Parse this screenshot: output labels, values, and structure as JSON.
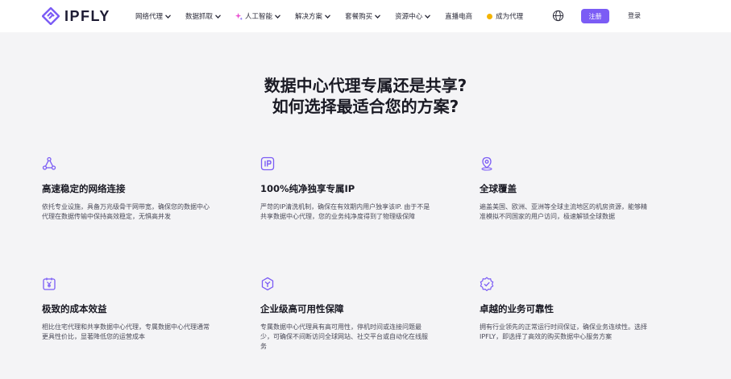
{
  "header": {
    "logo_text": "IPFLY",
    "nav": [
      {
        "label": "网络代理"
      },
      {
        "label": "数据抓取"
      },
      {
        "label": "人工智能"
      },
      {
        "label": "解决方案"
      },
      {
        "label": "套餐购买"
      },
      {
        "label": "资源中心"
      },
      {
        "label": "直播电商"
      },
      {
        "label": "成为代理"
      }
    ],
    "register_label": "注册",
    "login_label": "登录"
  },
  "main": {
    "heading_line1": "数据中心代理专属还是共享?",
    "heading_line2": "如何选择最适合您的方案?",
    "features": [
      {
        "icon": "network-icon",
        "title": "高速稳定的网络连接",
        "desc": "依托专业设施，具备万兆级骨干网带宽，确保您的数据中心代理在数据传输中保持高效稳定，无惧高并发"
      },
      {
        "icon": "ip-icon",
        "title": "100%纯净独享专属IP",
        "desc": "严苛的IP清洗机制，确保在有效期内用户独享该IP. 由于不是共享数据中心代理，您的业务纯净度得到了物理级保障"
      },
      {
        "icon": "location-pin-icon",
        "title": "全球覆盖",
        "desc": "遍盖美国、欧洲、亚洲等全球主流地区的机房资源，能够精准模拟不同国家的用户访问，极速解锁全球数据"
      },
      {
        "icon": "cost-icon",
        "title": "极致的成本效益",
        "desc": "相比住宅代理和共享数据中心代理，专属数据中心代理通常更具性价比，显著降低您的运营成本"
      },
      {
        "icon": "availability-icon",
        "title": "企业级高可用性保障",
        "desc": "专属数据中心代理具有高可用性，停机时间或连接问题最少，可确保不间断访问全球网站、社交平台或自动化在线服务"
      },
      {
        "icon": "reliability-icon",
        "title": "卓越的业务可靠性",
        "desc": "拥有行业领先的正常运行时间保证，确保业务连续性。选择 IPFLY，即选择了高效的购买数据中心服务方案"
      }
    ]
  },
  "colors": {
    "accent": "#7b5cf5",
    "coin": "#f4b400",
    "background": "#f4f4f6"
  }
}
